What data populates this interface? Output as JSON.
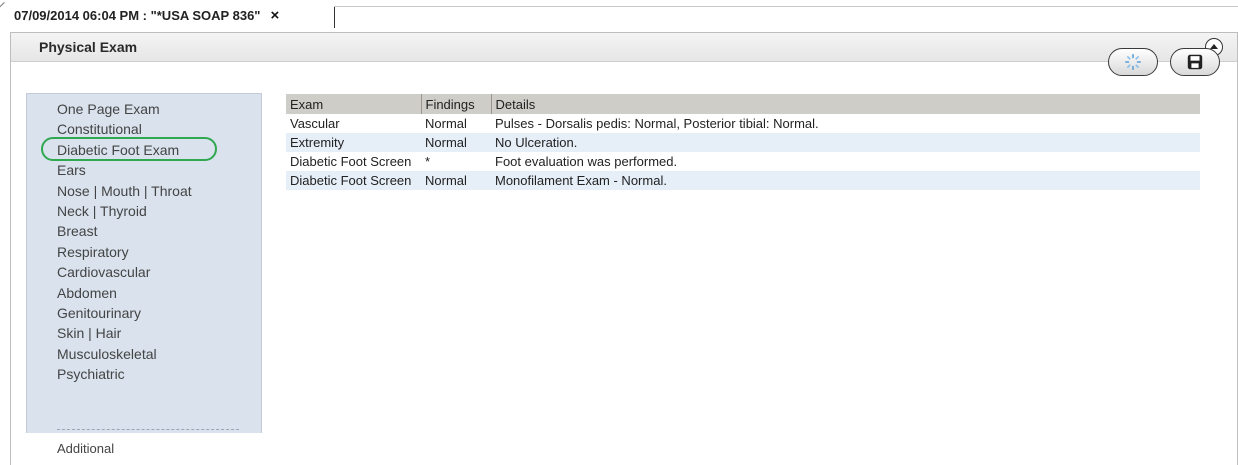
{
  "tab": {
    "title": "07/09/2014 06:04 PM : \"*USA SOAP 836\"",
    "close_label": "×"
  },
  "panel": {
    "title": "Physical Exam",
    "collapse_icon": "collapse-up-icon",
    "actions": [
      {
        "icon": "spinner-icon"
      },
      {
        "icon": "save-icon"
      }
    ]
  },
  "nav": {
    "items": [
      "One Page Exam",
      "Constitutional",
      "Diabetic Foot Exam",
      "Ears",
      "Nose | Mouth | Throat",
      "Neck | Thyroid",
      "Breast",
      "Respiratory",
      "Cardiovascular",
      "Abdomen",
      "Genitourinary",
      "Skin | Hair",
      "Musculoskeletal",
      "Psychiatric"
    ],
    "selected_index": 2,
    "highlight_color": "#2fa84f",
    "additional": "Additional"
  },
  "table": {
    "columns": [
      "Exam",
      "Findings",
      "Details"
    ],
    "rows": [
      {
        "exam": "Vascular",
        "findings": "Normal",
        "details": "Pulses - Dorsalis pedis: Normal, Posterior tibial: Normal."
      },
      {
        "exam": "Extremity",
        "findings": "Normal",
        "details": "No Ulceration."
      },
      {
        "exam": "Diabetic Foot Screen",
        "findings": "*",
        "details": "Foot evaluation was performed."
      },
      {
        "exam": "Diabetic Foot Screen",
        "findings": "Normal",
        "details": " Monofilament Exam - Normal."
      }
    ]
  },
  "colors": {
    "nav_bg": "#d9e2ed",
    "header_bg": "#cfcdc7",
    "alt_row_bg": "#e6eef8"
  }
}
